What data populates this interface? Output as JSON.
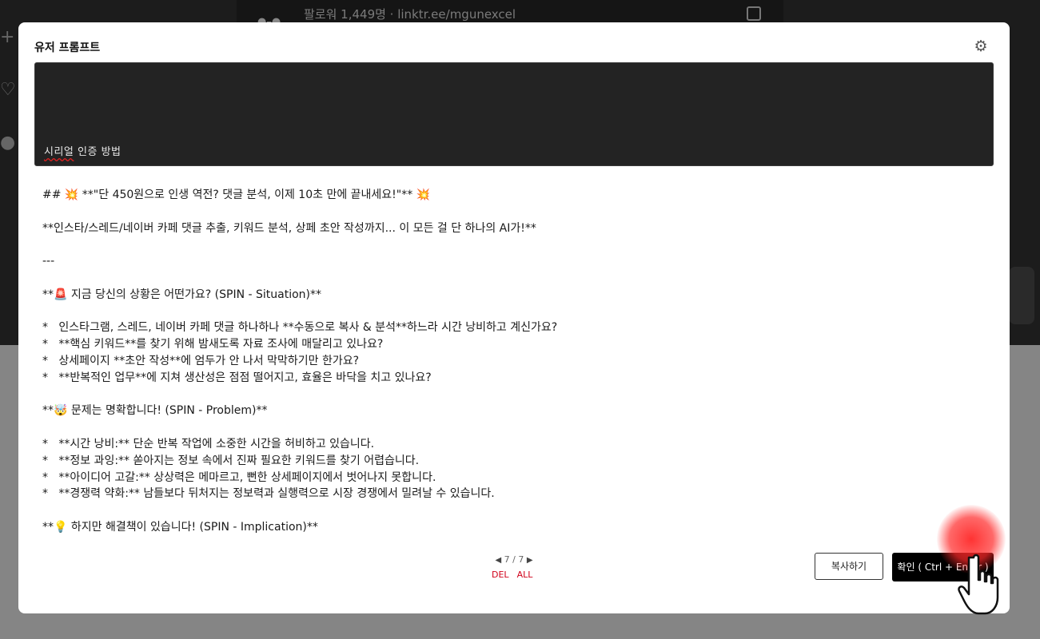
{
  "background": {
    "header_followers": "팔로워 1,449명 · linktr.ee/mgunexcel"
  },
  "modal": {
    "title": "유저 프롬프트",
    "settings_icon": "gear-icon",
    "prompt_input_value_part1": "시리얼",
    "prompt_input_value_part2": " 인증 방법"
  },
  "content_lines": [
    "## 💥 **\"단 450원으로 인생 역전? 댓글 분석, 이제 10초 만에 끝내세요!\"** 💥",
    "",
    "**인스타/스레드/네이버 카페 댓글 추출, 키워드 분석, 상페 초안 작성까지... 이 모든 걸 단 하나의 AI가!**",
    "",
    "---",
    "",
    "**🚨 지금 당신의 상황은 어떤가요? (SPIN - Situation)**",
    "",
    "*   인스타그램, 스레드, 네이버 카페 댓글 하나하나 **수동으로 복사 & 분석**하느라 시간 낭비하고 계신가요?",
    "*   **핵심 키워드**를 찾기 위해 밤새도록 자료 조사에 매달리고 있나요?",
    "*   상세페이지 **초안 작성**에 엄두가 안 나서 막막하기만 한가요?",
    "*   **반복적인 업무**에 지쳐 생산성은 점점 떨어지고, 효율은 바닥을 치고 있나요?",
    "",
    "**🤯 문제는 명확합니다! (SPIN - Problem)**",
    "",
    "*   **시간 낭비:** 단순 반복 작업에 소중한 시간을 허비하고 있습니다.",
    "*   **정보 과잉:** 쏟아지는 정보 속에서 진짜 필요한 키워드를 찾기 어렵습니다.",
    "*   **아이디어 고갈:** 상상력은 메마르고, 뻔한 상세페이지에서 벗어나지 못합니다.",
    "*   **경쟁력 약화:** 남들보다 뒤처지는 정보력과 실행력으로 시장 경쟁에서 밀려날 수 있습니다.",
    "",
    "**💡 하지만 해결책이 있습니다! (SPIN - Implication)**"
  ],
  "pager": {
    "prev_icon": "triangle-left-icon",
    "next_icon": "triangle-right-icon",
    "current": "7 / 7",
    "del_label": "DEL",
    "all_label": "ALL"
  },
  "buttons": {
    "copy_label": "복사하기",
    "confirm_label": "확인 ( Ctrl + Enter )"
  },
  "colors": {
    "modal_bg": "#ffffff",
    "prompt_bg": "#232323",
    "confirm_bg": "#000000",
    "pager_action": "#d0021b",
    "click_highlight": "#ff2828"
  }
}
